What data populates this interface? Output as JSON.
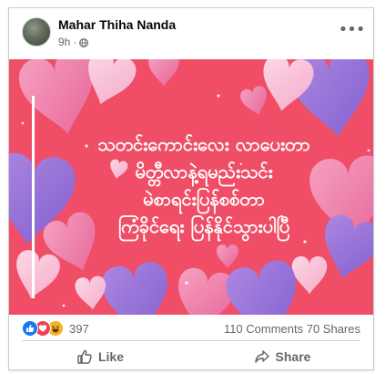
{
  "post": {
    "author": "Mahar Thiha Nanda",
    "time": "9h",
    "separator": "·",
    "privacy_icon": "globe-icon",
    "more_label": "•••",
    "text_lines": [
      "သတင်းကောင်းလေး လာပေးတာ",
      "မိတ္တီလာနဲ့ရမည်းသင်း",
      "မဲစာရင်းပြန်စစ်တာ",
      "ကြံခိုင်ရေး ပြန်နိုင်သွားပါပြီ"
    ],
    "background_color": "#ef4e66"
  },
  "stats": {
    "reaction_icons": [
      "like-icon",
      "love-icon",
      "haha-icon"
    ],
    "reaction_count": "397",
    "comments_shares": "110 Comments  70 Shares"
  },
  "actions": {
    "like_label": "Like",
    "share_label": "Share"
  }
}
